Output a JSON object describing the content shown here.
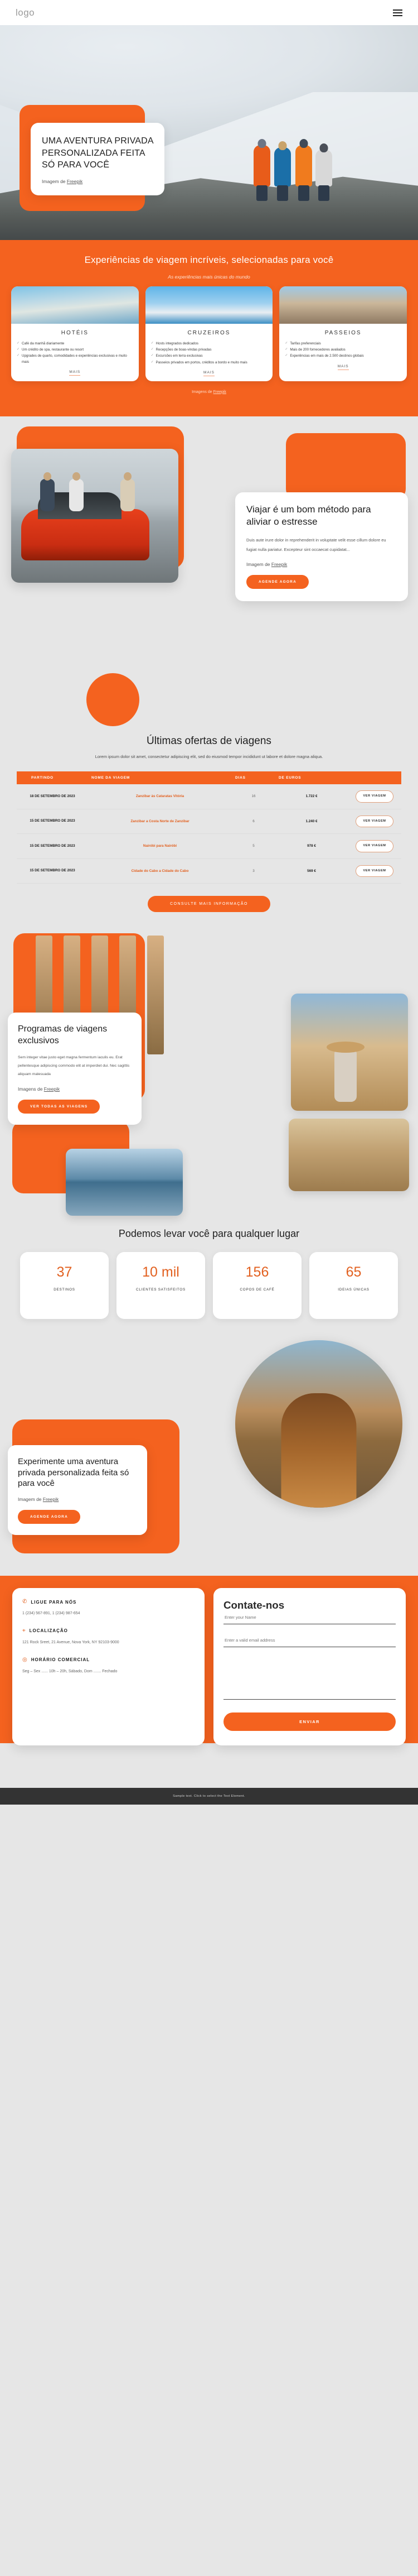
{
  "nav": {
    "logo": "logo",
    "menu_icon": "hamburger-icon"
  },
  "hero": {
    "title": "UMA AVENTURA PRIVADA PERSONALIZADA FEITA SÓ PARA VOCÊ",
    "credit_prefix": "Imagem de ",
    "credit_link": "Freepik"
  },
  "experiences": {
    "title": "Experiências de viagem incríveis, selecionadas para você",
    "subtitle": "As experiências mais únicas do mundo",
    "credit_prefix": "Imagens de ",
    "credit_link": "Freepik",
    "cards": [
      {
        "image_name": "hotel-pool-photo",
        "title": "HOTÉIS",
        "items": [
          "Café da manhã diariamente",
          "Um crédito de spa, restaurante ou resort",
          "Upgrades de quarto, comodidades e experiências exclusivas e muito mais"
        ],
        "more_label": "MAIS"
      },
      {
        "image_name": "cruise-ship-photo",
        "title": "CRUZEIROS",
        "items": [
          "Hosts integrados dedicados",
          "Recepções de boas-vindas privadas",
          "Excursões em terra exclusivas",
          "Passeios privados em portos, créditos a bordo e muito mais"
        ],
        "more_label": "MAIS"
      },
      {
        "image_name": "couple-city-photo",
        "title": "PASSEIOS",
        "items": [
          "Tarifas preferenciais",
          "Mais de 200 fornecedores avaliados",
          "Experiências em mais de 2.500 destinos globais"
        ],
        "more_label": "MAIS"
      }
    ]
  },
  "travel": {
    "image_name": "friends-red-car-photo",
    "title": "Viajar é um bom método para aliviar o estresse",
    "body": "Duis aute irure dolor in reprehenderit in voluptate velit esse cillum dolore eu fugiat nulla pariatur. Excepteur sint occaecat cupidatat...",
    "credit_prefix": "Imagem de ",
    "credit_link": "Freepik",
    "button": "AGENDE AGORA"
  },
  "offers": {
    "title": "Últimas ofertas de viagens",
    "lead": "Lorem ipsum dolor sit amet, consectetur adipiscing elit, sed do eiusmod tempor incididunt ut labore et dolore magna aliqua.",
    "columns": [
      "PARTINDO",
      "NOME DA VIAGEM",
      "DIAS",
      "DE EUROS",
      ""
    ],
    "rows": [
      {
        "date": "18 DE SETEMBRO DE 2023",
        "name": "Zanzibar às Cataratas Vitória",
        "days": "16",
        "price": "1.722 €",
        "cta": "VER VIAGEM"
      },
      {
        "date": "15 DE SETEMBRO DE 2023",
        "name": "Zanzibar a Costa Norte de Zanzibar",
        "days": "6",
        "price": "1.240 €",
        "cta": "VER VIAGEM"
      },
      {
        "date": "15 DE SETEMBRO DE 2023",
        "name": "Nairóbi para Nairóbi",
        "days": "5",
        "price": "978 €",
        "cta": "VER VIAGEM"
      },
      {
        "date": "15 DE SETEMBRO DE 2023",
        "name": "Cidade do Cabo a Cidade do Cabo",
        "days": "3",
        "price": "569 €",
        "cta": "VER VIAGEM"
      }
    ],
    "cta": "CONSULTE MAIS INFORMAÇÃO"
  },
  "programs": {
    "title": "Programas de viagens exclusivos",
    "body": "Sem integer vitae justo eget magna fermentum iaculis eu. Erat pellentesque adipiscing commodo elit at imperdiet dui. Nec sagittis aliquam malesuada",
    "credit_prefix": "Imagens de ",
    "credit_link": "Freepik",
    "button": "VER TODAS AS VIAGENS",
    "images": [
      "egypt-temple-photo",
      "desert-hiker-photo",
      "lake-reflection-photo",
      "sand-dunes-photo"
    ]
  },
  "stats": {
    "title": "Podemos levar você para qualquer lugar",
    "items": [
      {
        "number": "37",
        "label": "DESTINOS"
      },
      {
        "number": "10 mil",
        "label": "CLIENTES SATISFEITOS"
      },
      {
        "number": "156",
        "label": "COPOS DE CAFÉ"
      },
      {
        "number": "65",
        "label": "IDEIAS ÚNICAS"
      }
    ]
  },
  "experience": {
    "image_name": "woman-sunset-photo",
    "title": "Experimente uma aventura privada personalizada feita só para você",
    "credit_prefix": "Imagem de ",
    "credit_link": "Freepik",
    "button": "AGENDE AGORA"
  },
  "contact": {
    "info": [
      {
        "icon": "phone-icon",
        "title": "LIGUE PARA NÓS",
        "text": "1 (234) 567-891, 1 (234) 987-654"
      },
      {
        "icon": "location-pin-icon",
        "title": "LOCALIZAÇÃO",
        "text": "121 Rock Sreet, 21 Avenue, Nova York, NY 92103-9000"
      },
      {
        "icon": "clock-24h-icon",
        "title": "HORÁRIO COMERCIAL",
        "text": "Seg – Sex ...... 10h – 20h, Sábado, Dom ....... Fechado"
      }
    ],
    "form": {
      "title": "Contate-nos",
      "name_placeholder": "Enter your Name",
      "email_placeholder": "Enter a valid email address",
      "message_placeholder": "",
      "submit": "ENVIAR"
    }
  },
  "footer": {
    "text": "Sample text. Click to select the Text Element."
  },
  "colors": {
    "accent": "#f4621f",
    "accent_text": "#e2601f",
    "page_bg": "#e6e6e6",
    "footer_bg": "#333333"
  }
}
